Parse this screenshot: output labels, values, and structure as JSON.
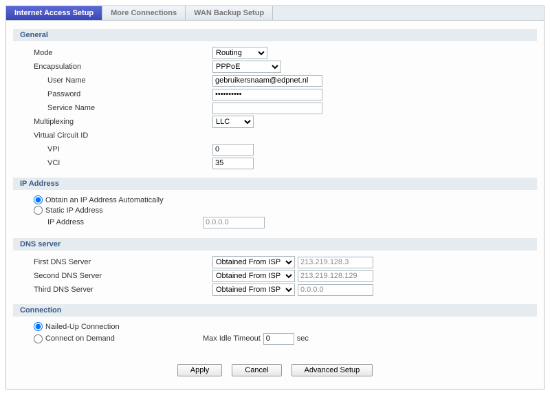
{
  "tabs": {
    "internet": "Internet Access Setup",
    "more": "More Connections",
    "wan": "WAN Backup Setup"
  },
  "sections": {
    "general": "General",
    "ip": "IP Address",
    "dns": "DNS server",
    "connection": "Connection"
  },
  "general": {
    "mode_label": "Mode",
    "mode_value": "Routing",
    "encap_label": "Encapsulation",
    "encap_value": "PPPoE",
    "user_label": "User Name",
    "user_value": "gebruikersnaam@edpnet.nl",
    "password_label": "Password",
    "password_value": "••••••••••",
    "service_label": "Service Name",
    "service_value": "",
    "mux_label": "Multiplexing",
    "mux_value": "LLC",
    "vci_title": "Virtual Circuit ID",
    "vpi_label": "VPI",
    "vpi_value": "0",
    "vci_label": "VCI",
    "vci_value": "35"
  },
  "ip": {
    "auto_label": "Obtain an IP Address Automatically",
    "static_label": "Static IP Address",
    "ipaddr_label": "IP Address",
    "ipaddr_value": "0.0.0.0"
  },
  "dns": {
    "first_label": "First DNS Server",
    "second_label": "Second DNS Server",
    "third_label": "Third DNS Server",
    "mode_value": "Obtained From ISP",
    "first_value": "213.219.128.3",
    "second_value": "213.219.128.129",
    "third_value": "0.0.0.0"
  },
  "conn": {
    "nailed_label": "Nailed-Up Connection",
    "demand_label": "Connect on Demand",
    "idle_label": "Max Idle Timeout",
    "idle_value": "0",
    "idle_unit": "sec"
  },
  "buttons": {
    "apply": "Apply",
    "cancel": "Cancel",
    "advanced": "Advanced Setup"
  }
}
